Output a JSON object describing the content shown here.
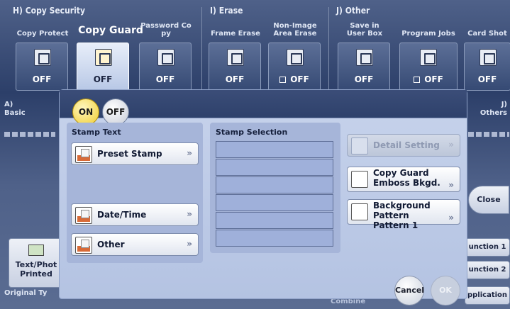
{
  "header": {
    "groups": [
      {
        "title": "H)  Copy Security"
      },
      {
        "title": "I)  Erase"
      },
      {
        "title": "J)  Other"
      }
    ],
    "functions": [
      {
        "label": "Copy Protect",
        "value": "OFF"
      },
      {
        "label": "Copy Guard",
        "value": "OFF"
      },
      {
        "label": "Password Co\npy",
        "value": "OFF"
      },
      {
        "label": "Frame Erase",
        "value": "OFF"
      },
      {
        "label": "Non-Image\nArea Erase",
        "value": "OFF"
      },
      {
        "label": "Save in\nUser Box",
        "value": "OFF"
      },
      {
        "label": "Program Jobs",
        "value": "OFF"
      },
      {
        "label": "Card Shot",
        "value": "OFF"
      }
    ]
  },
  "side": {
    "left_top": "A)\nBasic",
    "right_top": "J)\nOthers",
    "left_bottom_btn": "Text/Phot\nPrinted",
    "original_type": "Original Ty",
    "combine": "Combine",
    "close": "Close",
    "function1": "unction 1",
    "function2": "unction 2",
    "application": "pplication"
  },
  "dialog": {
    "on_label": "ON",
    "off_label": "OFF",
    "stamp_text_title": "Stamp Text",
    "preset_stamp": "Preset Stamp",
    "date_time": "Date/Time",
    "other": "Other",
    "stamp_selection_title": "Stamp Selection",
    "stamp_slots": [
      "",
      "",
      "",
      "",
      "",
      ""
    ],
    "detail_setting": "Detail Setting",
    "copy_guard_emboss_line1": "Copy Guard",
    "copy_guard_emboss_line2": "Emboss Bkgd.",
    "bg_pattern_line1": "Background Pattern",
    "bg_pattern_line2": "Pattern 1",
    "cancel": "Cancel",
    "ok": "OK"
  },
  "colors": {
    "on_button": "#f0cd2e",
    "dialog_bg": "#c7d3ec",
    "header_bg": "#3b4d78"
  }
}
